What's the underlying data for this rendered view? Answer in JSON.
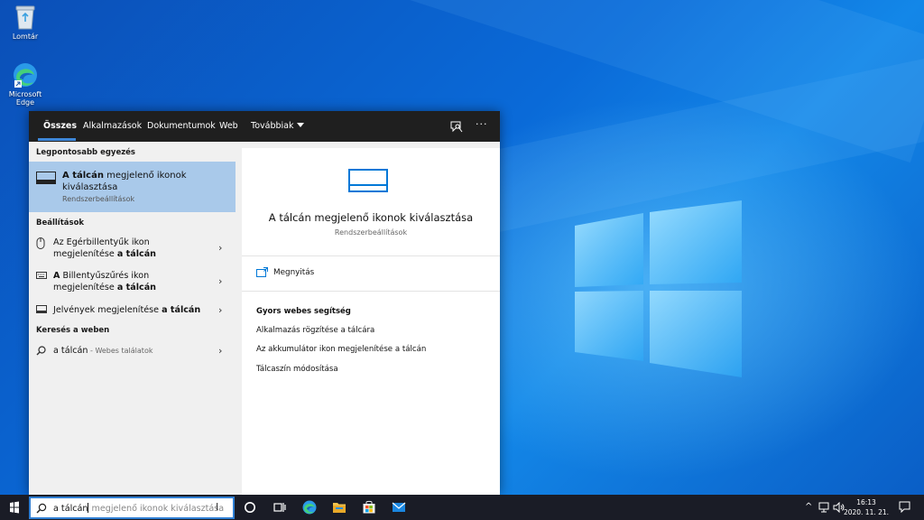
{
  "desktop": {
    "icons": [
      {
        "name": "recycle-bin",
        "label": "Lomtár"
      },
      {
        "name": "microsoft-edge",
        "label": "Microsoft Edge"
      }
    ]
  },
  "search": {
    "tabs": [
      {
        "label": "Összes",
        "active": true
      },
      {
        "label": "Alkalmazások"
      },
      {
        "label": "Dokumentumok"
      },
      {
        "label": "Web"
      },
      {
        "label": "Továbbiak"
      }
    ],
    "best_match_heading": "Legpontosabb egyezés",
    "best_match": {
      "title_bold": "A tálcán",
      "title_rest": " megjelenő ikonok kiválasztása",
      "subtitle": "Rendszerbeállítások"
    },
    "settings_heading": "Beállítások",
    "settings_items": [
      {
        "pre": "Az Egérbillentyűk ikon megjelenítése ",
        "bold": "a tálcán",
        "post": ""
      },
      {
        "pre": "",
        "bold": "A",
        "post": " Billentyűszűrés ikon megjelenítése ",
        "bold2": "a tálcán"
      },
      {
        "pre": "Jelvények megjelenítése ",
        "bold": "a tálcán",
        "post": ""
      }
    ],
    "web_heading": "Keresés a weben",
    "web_item": {
      "query": "a tálcán",
      "suffix": " - Webes találatok"
    },
    "detail": {
      "title": "A tálcán megjelenő ikonok kiválasztása",
      "subtitle": "Rendszerbeállítások",
      "open_label": "Megnyitás",
      "web_help_heading": "Gyors webes segítség",
      "help_links": [
        "Alkalmazás rögzítése a tálcára",
        "Az akkumulátor ikon megjelenítése a tálcán",
        "Tálcaszín módosítása"
      ]
    }
  },
  "taskbar": {
    "search_typed": "a tálcán",
    "search_suggestion": "megjelenő ikonok kiválasztása",
    "clock_time": "16:13",
    "clock_date": "2020. 11. 21."
  },
  "colors": {
    "accent": "#0078d7",
    "selection": "#a9c9ea",
    "taskbar": "#1a1c26"
  }
}
